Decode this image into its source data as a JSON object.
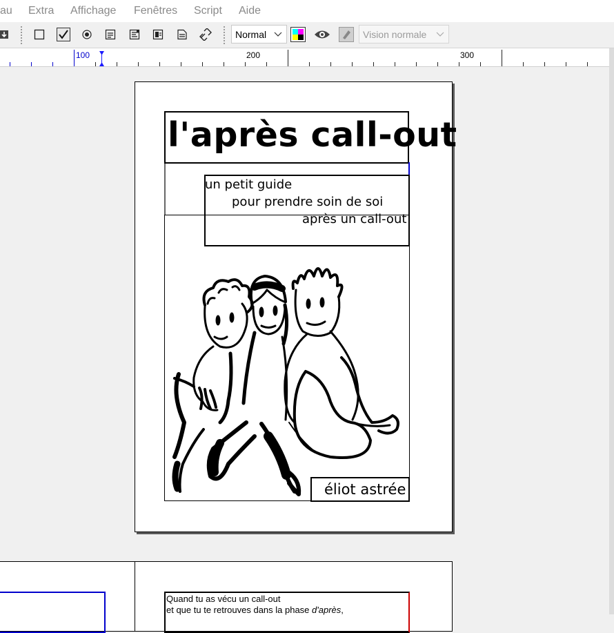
{
  "menu": {
    "items": [
      "au",
      "Extra",
      "Affichage",
      "Fenêtres",
      "Script",
      "Aide"
    ]
  },
  "toolbar": {
    "zoom_combo": "Normal",
    "view_combo": "Vision normale",
    "icons": [
      "import-icon",
      "frame-icon",
      "checkbox-icon",
      "radio-icon",
      "text-field-icon",
      "list-box-icon",
      "combo-box-icon",
      "pdf-text-icon",
      "link-icon",
      "color-icon",
      "eye-icon",
      "edit-in-preview-icon"
    ]
  },
  "ruler": {
    "labels": [
      "100",
      "200",
      "300"
    ]
  },
  "page1": {
    "title": "l'après call-out",
    "subtitle_line1": "un petit guide",
    "subtitle_line2": "pour prendre soin de soi",
    "subtitle_line3": "après un call-out",
    "author": "éliot astrée"
  },
  "page2": {
    "line1": "Quand tu as vécu un call-out",
    "line2_start": "et que tu te retrouves dans la phase ",
    "line2_italic": "d'après",
    "line2_end": ","
  },
  "colors": {
    "menu_text": "#8a8a8a",
    "ruler_marker": "#0000ff",
    "frame_accent": "#0000cc",
    "text_frame_red": "#cc0000"
  }
}
